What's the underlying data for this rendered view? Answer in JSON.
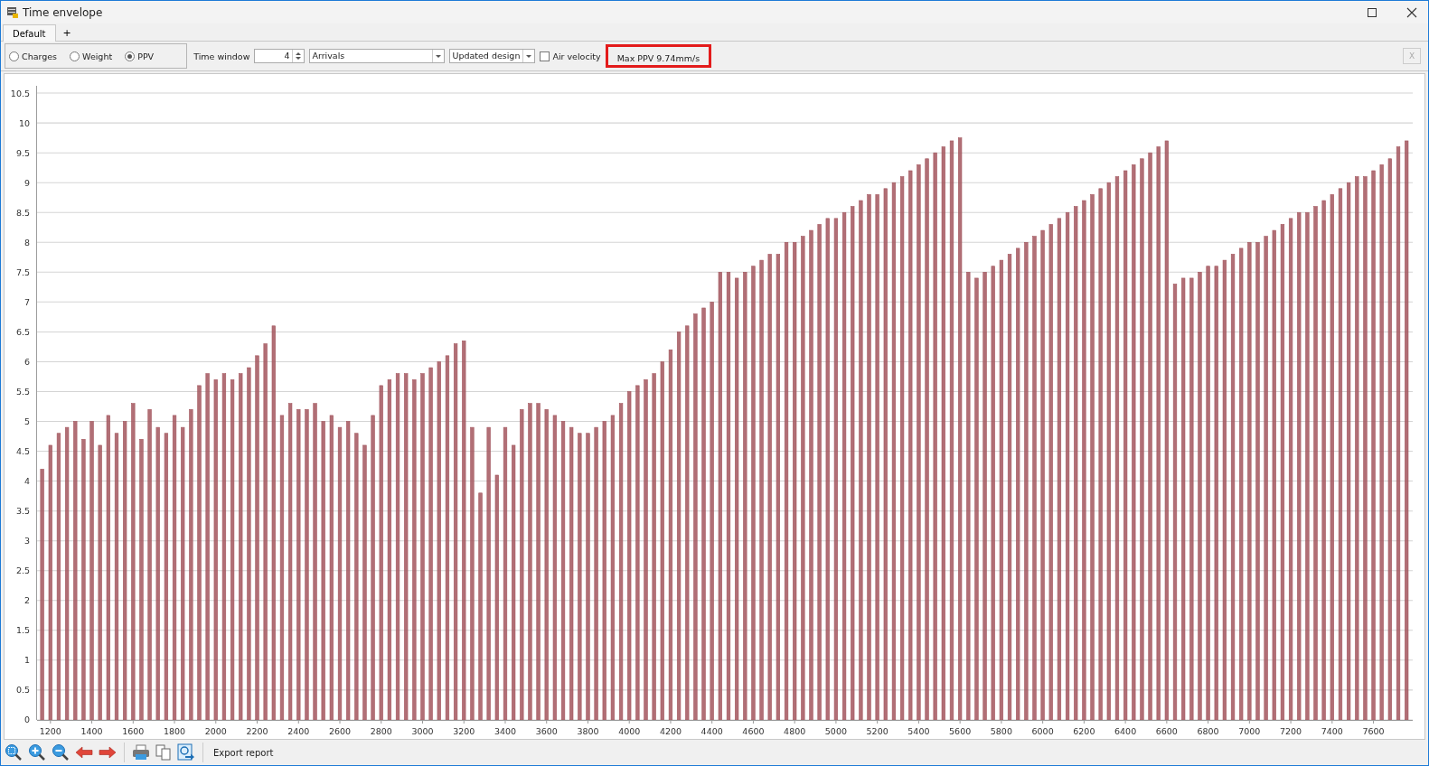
{
  "window": {
    "title": "Time envelope"
  },
  "tabs": [
    {
      "label": "Default",
      "selected": true
    }
  ],
  "add_tab": "+",
  "toolbar": {
    "modes": [
      {
        "label": "Charges",
        "selected": false
      },
      {
        "label": "Weight",
        "selected": false
      },
      {
        "label": "PPV",
        "selected": true
      }
    ],
    "time_window": {
      "label": "Time window",
      "value": "4"
    },
    "dropdowns": [
      {
        "value": "Arrivals"
      },
      {
        "value": "Updated design"
      }
    ],
    "air_velocity": {
      "label": "Air velocity",
      "checked": false
    },
    "max_ppv": {
      "text": "Max PPV 9.74mm/s",
      "highlighted": true
    },
    "close_button": {
      "label": "X",
      "disabled": true
    }
  },
  "chart": {
    "chart_data": {
      "type": "bar",
      "grid": true,
      "xlim": [
        1135,
        7790
      ],
      "ylim": [
        0,
        10.5
      ],
      "xticks": [
        1200,
        1400,
        1600,
        1800,
        2000,
        2200,
        2400,
        2600,
        2800,
        3000,
        3200,
        3400,
        3600,
        3800,
        4000,
        4200,
        4400,
        4600,
        4800,
        5000,
        5200,
        5400,
        5600,
        5800,
        6000,
        6200,
        6400,
        6600,
        6800,
        7000,
        7200,
        7400,
        7600
      ],
      "yticks": [
        0,
        0.5,
        1,
        1.5,
        2,
        2.5,
        3,
        3.5,
        4,
        4.5,
        5,
        5.5,
        6,
        6.5,
        7,
        7.5,
        8,
        8.5,
        9,
        9.5,
        10,
        10.5
      ],
      "x": [
        1160,
        1200,
        1240,
        1280,
        1320,
        1360,
        1400,
        1440,
        1480,
        1520,
        1560,
        1600,
        1640,
        1680,
        1720,
        1760,
        1800,
        1840,
        1880,
        1920,
        1960,
        2000,
        2040,
        2080,
        2120,
        2160,
        2200,
        2240,
        2280,
        2320,
        2360,
        2400,
        2440,
        2480,
        2520,
        2560,
        2600,
        2640,
        2680,
        2720,
        2760,
        2800,
        2840,
        2880,
        2920,
        2960,
        3000,
        3040,
        3080,
        3120,
        3160,
        3200,
        3240,
        3280,
        3320,
        3360,
        3400,
        3440,
        3480,
        3520,
        3560,
        3600,
        3640,
        3680,
        3720,
        3760,
        3800,
        3840,
        3880,
        3920,
        3960,
        4000,
        4040,
        4080,
        4120,
        4160,
        4200,
        4240,
        4280,
        4320,
        4360,
        4400,
        4440,
        4480,
        4520,
        4560,
        4600,
        4640,
        4680,
        4720,
        4760,
        4800,
        4840,
        4880,
        4920,
        4960,
        5000,
        5040,
        5080,
        5120,
        5160,
        5200,
        5240,
        5280,
        5320,
        5360,
        5400,
        5440,
        5480,
        5520,
        5560,
        5600,
        5640,
        5680,
        5720,
        5760,
        5800,
        5840,
        5880,
        5920,
        5960,
        6000,
        6040,
        6080,
        6120,
        6160,
        6200,
        6240,
        6280,
        6320,
        6360,
        6400,
        6440,
        6480,
        6520,
        6560,
        6600,
        6640,
        6680,
        6720,
        6760,
        6800,
        6840,
        6880,
        6920,
        6960,
        7000,
        7040,
        7080,
        7120,
        7160,
        7200,
        7240,
        7280,
        7320,
        7360,
        7400,
        7440,
        7480,
        7520,
        7560,
        7600,
        7640,
        7680,
        7720,
        7760
      ],
      "series": [
        {
          "color": "#a3565e",
          "values": [
            4.2,
            4.6,
            4.8,
            4.9,
            5.0,
            4.7,
            5.0,
            4.6,
            5.1,
            4.8,
            5.0,
            5.3,
            4.7,
            5.2,
            4.9,
            4.8,
            5.1,
            4.9,
            5.2,
            5.6,
            5.8,
            5.7,
            5.8,
            5.7,
            5.8,
            5.9,
            6.1,
            6.3,
            6.6,
            5.1,
            5.3,
            5.2,
            5.2,
            5.3,
            5.0,
            5.1,
            4.9,
            5.0,
            4.8,
            4.6,
            5.1,
            5.6,
            5.7,
            5.8,
            5.8,
            5.7,
            5.8,
            5.9,
            6.0,
            6.1,
            6.3,
            6.35,
            4.9,
            3.8,
            4.9,
            4.1,
            4.9,
            4.6,
            5.2,
            5.3,
            5.3,
            5.2,
            5.1,
            5.0,
            4.9,
            4.8,
            4.8,
            4.9,
            5.0,
            5.1,
            5.3,
            5.5,
            5.6,
            5.7,
            5.8,
            6.0,
            6.2,
            6.5,
            6.6,
            6.8,
            6.9,
            7.0,
            7.5,
            7.5,
            7.4,
            7.5,
            7.6,
            7.7,
            7.8,
            7.8,
            8.0,
            8.0,
            8.1,
            8.2,
            8.3,
            8.4,
            8.4,
            8.5,
            8.6,
            8.7,
            8.8,
            8.8,
            8.9,
            9.0,
            9.1,
            9.2,
            9.3,
            9.4,
            9.5,
            9.6,
            9.7,
            9.75,
            7.5,
            7.4,
            7.5,
            7.6,
            7.7,
            7.8,
            7.9,
            8.0,
            8.1,
            8.2,
            8.3,
            8.4,
            8.5,
            8.6,
            8.7,
            8.8,
            8.9,
            9.0,
            9.1,
            9.2,
            9.3,
            9.4,
            9.5,
            9.6,
            9.7,
            7.3,
            7.4,
            7.4,
            7.5,
            7.6,
            7.6,
            7.7,
            7.8,
            7.9,
            8.0,
            8.0,
            8.1,
            8.2,
            8.3,
            8.4,
            8.5,
            8.5,
            8.6,
            8.7,
            8.8,
            8.9,
            9.0,
            9.1,
            9.1,
            9.2,
            9.3,
            9.4,
            9.6,
            9.7
          ]
        }
      ]
    }
  },
  "bottom_toolbar": {
    "export_label": "Export report"
  }
}
